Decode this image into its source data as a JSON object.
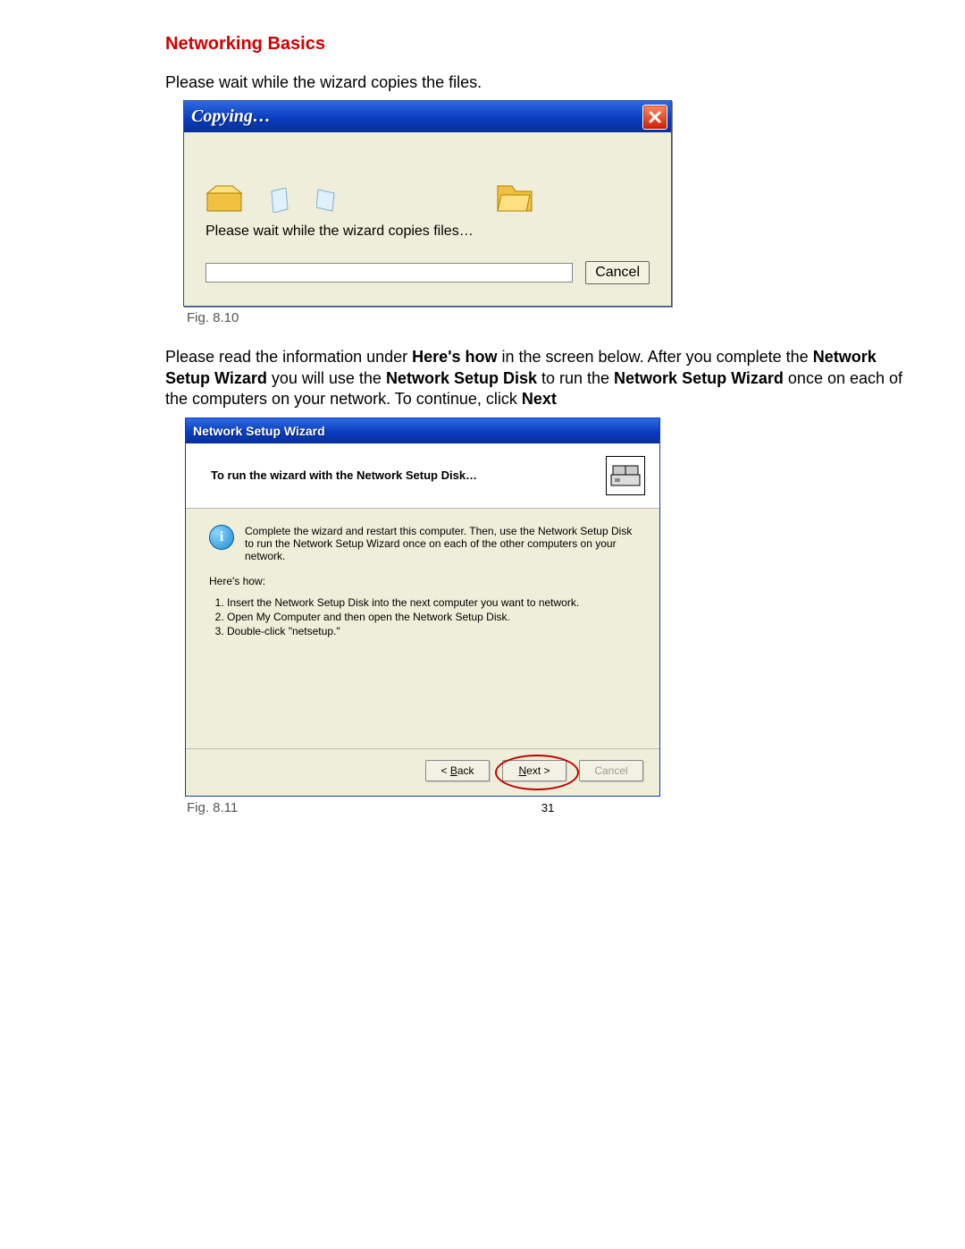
{
  "heading": "Networking Basics",
  "intro1": "Please wait while the wizard copies the files.",
  "dlg1": {
    "title": "Copying…",
    "body_text": "Please wait while the wizard copies files…",
    "cancel": "Cancel"
  },
  "fig1": "Fig. 8.10",
  "para2_pre": "Please read the information under ",
  "para2_b1": "Here's how",
  "para2_mid1": " in the screen below.  After you complete the ",
  "para2_b2": "Network Setup Wizard",
  "para2_mid2": " you will use the ",
  "para2_b3": "Network Setup Disk",
  "para2_mid3": " to run the ",
  "para2_b4": "Network Setup Wizard",
  "para2_mid4": " once on each of the computers on your network.  To continue, click ",
  "para2_b5": "Next",
  "dlg2": {
    "title": "Network Setup Wizard",
    "header": "To run the wizard with the Network Setup Disk…",
    "info": "Complete the wizard and restart this computer. Then, use the Network Setup Disk to run the Network Setup Wizard once on each of the other computers on your network.",
    "hereshow": "Here's how:",
    "steps": [
      "Insert the Network Setup Disk into the next computer you want to network.",
      "Open My Computer and then open the Network Setup Disk.",
      "Double-click \"netsetup.\""
    ],
    "back_pre": "< ",
    "back_hot": "B",
    "back_post": "ack",
    "next_hot": "N",
    "next_post": "ext >",
    "cancel": "Cancel"
  },
  "fig2": "Fig. 8.11",
  "pagenum": "31"
}
